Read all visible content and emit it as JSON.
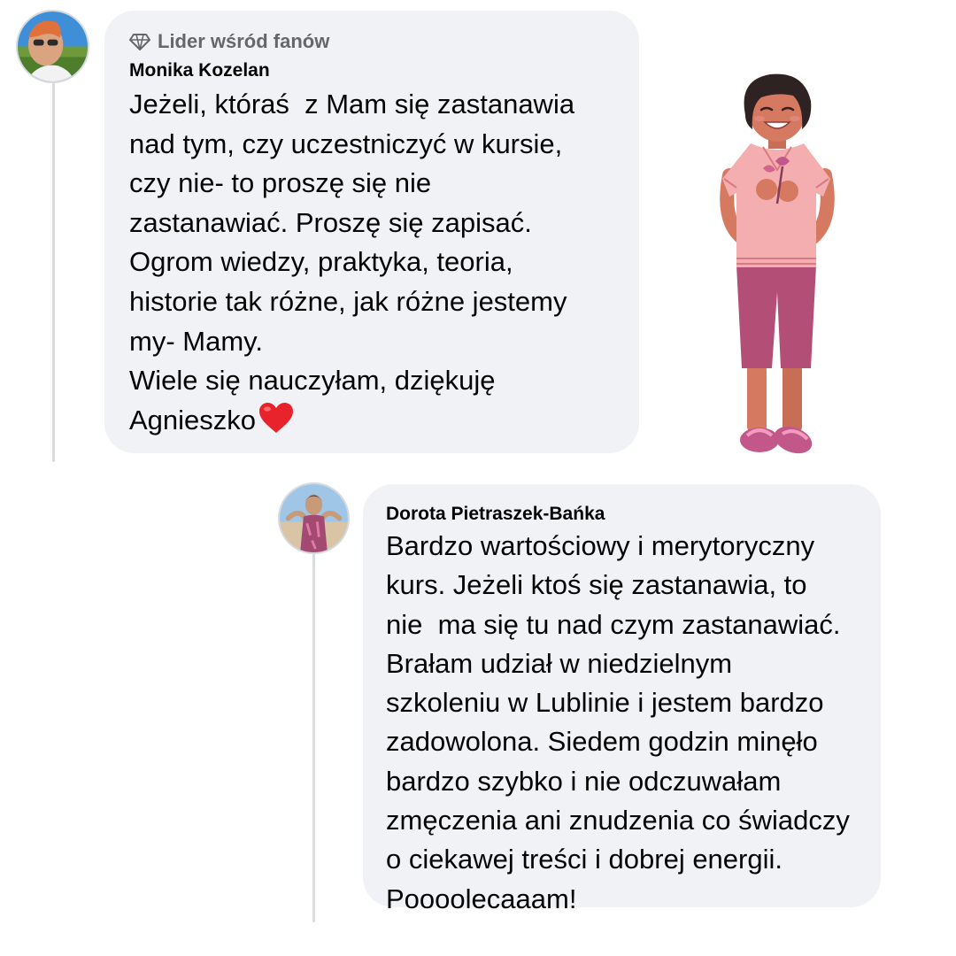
{
  "comments": [
    {
      "badge": "Lider wśród fanów",
      "author": "Monika Kozelan",
      "lines": [
        "Jeżeli, któraś  z Mam się zastanawia",
        "nad tym, czy uczestniczyć w kursie,",
        "czy nie- to proszę się nie",
        "zastanawiać. Proszę się zapisać.",
        "Ogrom wiedzy, praktyka, teoria,",
        "historie tak różne, jak różne jestemy",
        "my- Mamy.",
        "Wiele się nauczyłam, dziękuję",
        "Agnieszko"
      ],
      "end_icon": "heart-emoji"
    },
    {
      "author": "Dorota Pietraszek-Bańka",
      "lines": [
        "Bardzo wartościowy i merytoryczny",
        "kurs. Jeżeli ktoś się zastanawia, to",
        "nie  ma się tu nad czym zastanawiać.",
        "Brałam udział w niedzielnym",
        "szkoleniu w Lublinie i jestem bardzo",
        "zadowolona. Siedem godzin minęło",
        "bardzo szybko i nie odczuwałam",
        "zmęczenia ani znudzenia co świadczy",
        "o ciekawej treści i dobrej energii.",
        "Poooolecaaam!"
      ]
    }
  ],
  "icons": {
    "badge": "diamond-icon",
    "end": "heart-emoji"
  },
  "colors": {
    "bubble": "#f0f2f5",
    "badge_text": "#65676b",
    "heart": "#e8232b"
  }
}
